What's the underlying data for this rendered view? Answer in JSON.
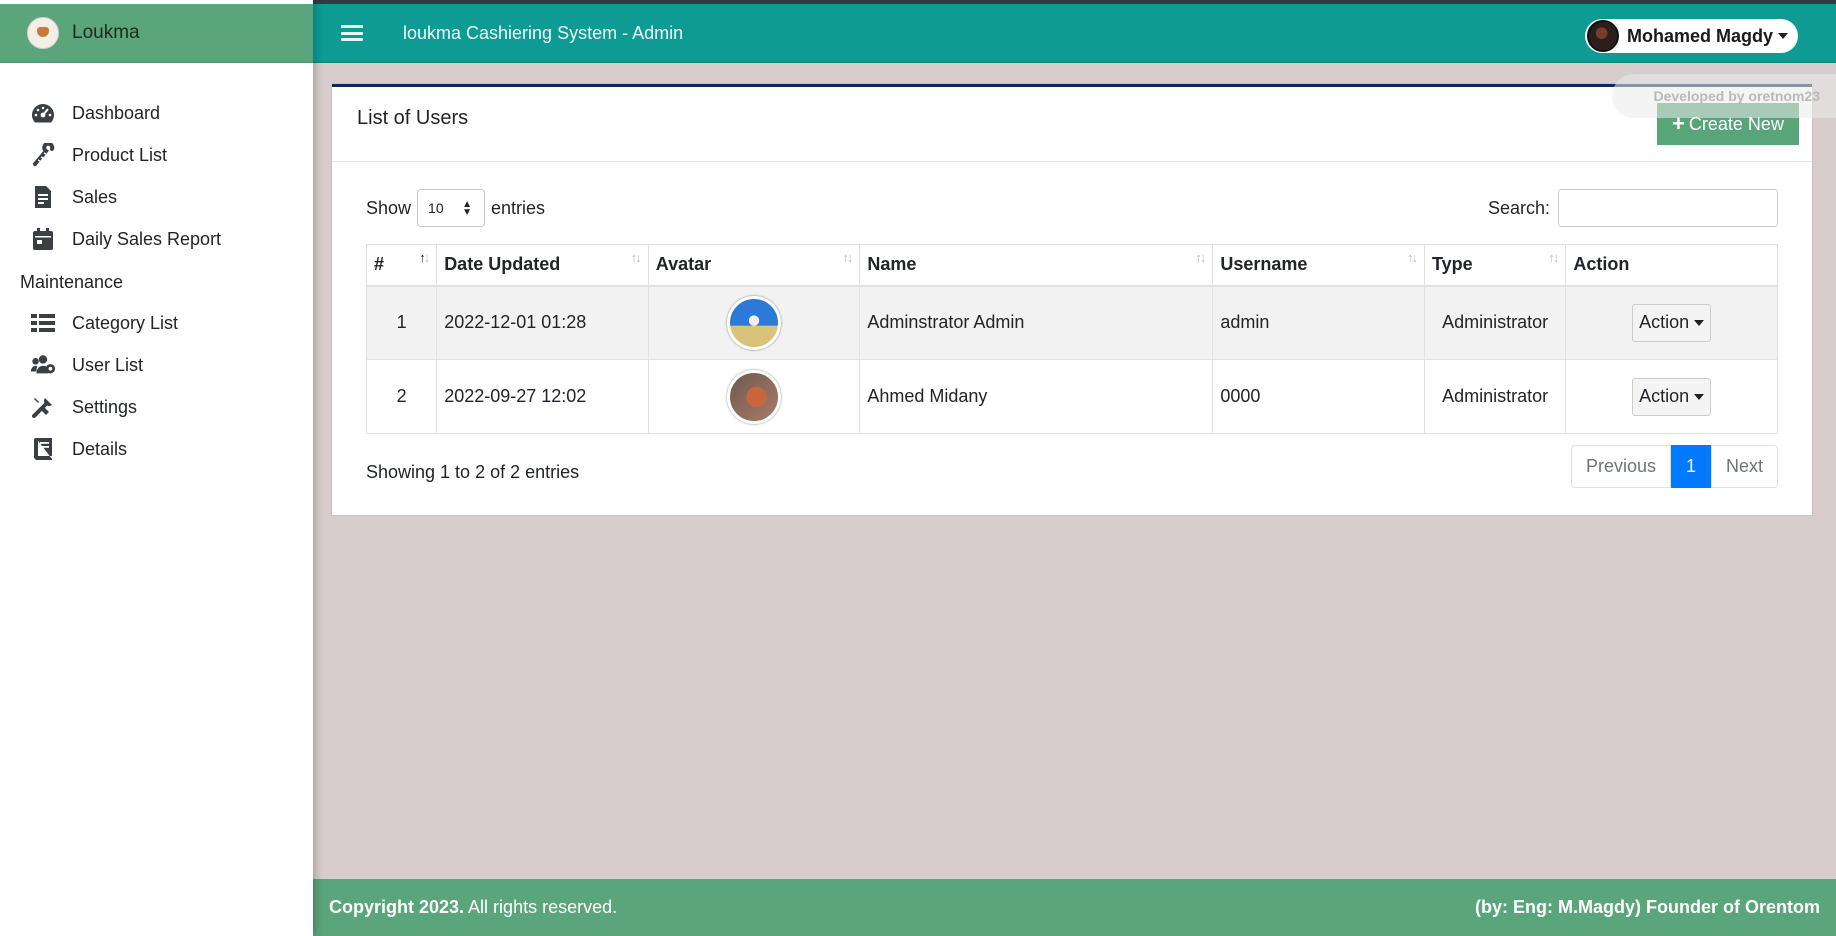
{
  "brand": {
    "name": "Loukma",
    "logo_icon": "bowl-logo-icon"
  },
  "header": {
    "title": "loukma Cashiering System - Admin",
    "menu_icon": "hamburger-icon",
    "user_name": "Mohamed Magdy"
  },
  "sidebar": {
    "items": [
      {
        "label": "Dashboard",
        "icon": "tachometer-icon"
      },
      {
        "label": "Product List",
        "icon": "candy-cane-icon"
      },
      {
        "label": "Sales",
        "icon": "file-invoice-icon"
      },
      {
        "label": "Daily Sales Report",
        "icon": "calendar-icon"
      }
    ],
    "section_header": "Maintenance",
    "maintenance_items": [
      {
        "label": "Category List",
        "icon": "list-icon"
      },
      {
        "label": "User List",
        "icon": "users-cog-icon"
      },
      {
        "label": "Settings",
        "icon": "tools-icon"
      },
      {
        "label": "Details",
        "icon": "book-icon"
      }
    ]
  },
  "card": {
    "title": "List of Users",
    "create_label": "Create New"
  },
  "watermark": "Developed by oretnom23",
  "table_controls": {
    "show_label": "Show",
    "entries_label": "entries",
    "page_length": "10",
    "search_label": "Search:",
    "search_value": ""
  },
  "table": {
    "columns": [
      "#",
      "Date Updated",
      "Avatar",
      "Name",
      "Username",
      "Type",
      "Action"
    ],
    "rows": [
      {
        "num": "1",
        "date": "2022-12-01 01:28",
        "name": "Adminstrator Admin",
        "username": "admin",
        "type": "Administrator",
        "action": "Action"
      },
      {
        "num": "2",
        "date": "2022-09-27 12:02",
        "name": "Ahmed Midany",
        "username": "0000",
        "type": "Administrator",
        "action": "Action"
      }
    ]
  },
  "pagination": {
    "info": "Showing 1 to 2 of 2 entries",
    "previous": "Previous",
    "current": "1",
    "next": "Next"
  },
  "footer": {
    "copyright_bold": "Copyright 2023.",
    "copyright_rest": " All rights reserved.",
    "credit": "(by: Eng: M.Magdy) Founder of Orentom"
  },
  "colors": {
    "brand_green": "#5aa57b",
    "header_teal": "#0d9b94",
    "primary_blue": "#007bff",
    "page_bg": "#d6cdcc"
  }
}
